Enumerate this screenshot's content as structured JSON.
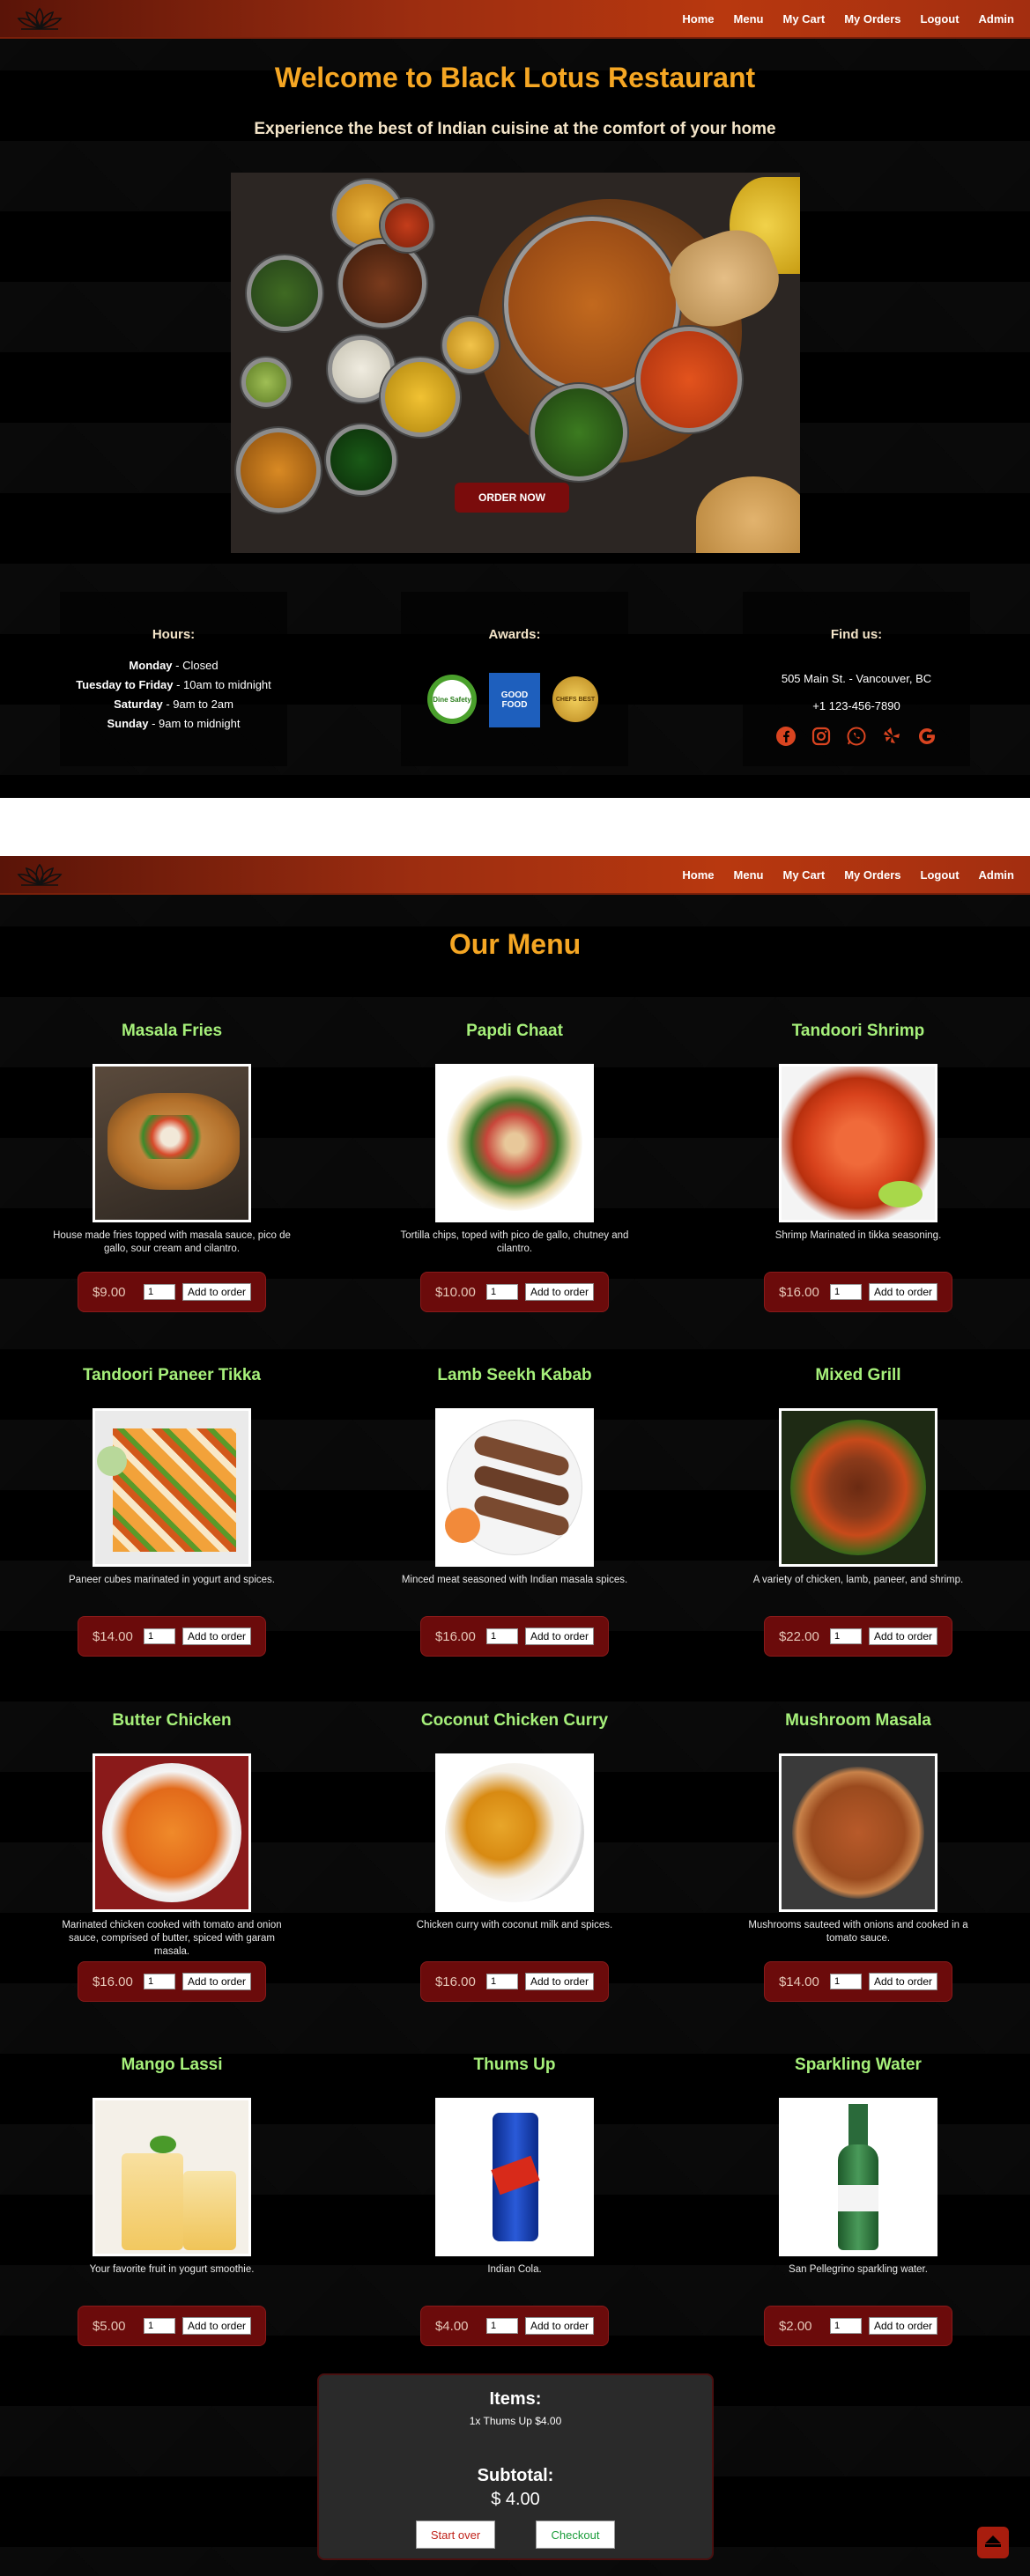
{
  "nav": {
    "items": [
      {
        "label": "Home"
      },
      {
        "label": "Menu"
      },
      {
        "label": "My Cart"
      },
      {
        "label": "My Orders"
      },
      {
        "label": "Logout"
      },
      {
        "label": "Admin"
      }
    ]
  },
  "home": {
    "title": "Welcome to Black Lotus Restaurant",
    "tagline": "Experience the best of Indian cuisine at the comfort of your home",
    "order_now": "ORDER NOW",
    "hours": {
      "title": "Hours:",
      "rows": [
        {
          "day": "Monday",
          "time": " - Closed"
        },
        {
          "day": "Tuesday to Friday",
          "time": " - 10am to midnight"
        },
        {
          "day": "Saturday",
          "time": " - 9am to 2am"
        },
        {
          "day": "Sunday",
          "time": " - 9am to midnight"
        }
      ]
    },
    "awards": {
      "title": "Awards:",
      "badges": [
        "Dine Safety",
        "GOOD FOOD",
        "CHEFS BEST"
      ]
    },
    "find_us": {
      "title": "Find us:",
      "address": "505 Main St. - Vancouver, BC",
      "phone": "+1 123-456-7890"
    }
  },
  "menu": {
    "title": "Our Menu",
    "add_label": "Add to order",
    "qty_default": "1",
    "items": [
      {
        "name": "Masala Fries",
        "desc": "House made fries topped with masala sauce, pico de gallo, sour cream and cilantro.",
        "price": "$9.00"
      },
      {
        "name": "Papdi Chaat",
        "desc": "Tortilla chips, toped with pico de gallo, chutney and cilantro.",
        "price": "$10.00"
      },
      {
        "name": "Tandoori Shrimp",
        "desc": "Shrimp Marinated in tikka seasoning.",
        "price": "$16.00"
      },
      {
        "name": "Tandoori Paneer Tikka",
        "desc": "Paneer cubes marinated in yogurt and spices.",
        "price": "$14.00"
      },
      {
        "name": "Lamb Seekh Kabab",
        "desc": "Minced meat seasoned with Indian masala spices.",
        "price": "$16.00"
      },
      {
        "name": "Mixed Grill",
        "desc": "A variety of chicken, lamb, paneer, and shrimp.",
        "price": "$22.00"
      },
      {
        "name": "Butter Chicken",
        "desc": "Marinated chicken cooked with tomato and onion sauce, comprised of butter, spiced with garam masala.",
        "price": "$16.00"
      },
      {
        "name": "Coconut Chicken Curry",
        "desc": "Chicken curry with coconut milk and spices.",
        "price": "$16.00"
      },
      {
        "name": "Mushroom Masala",
        "desc": "Mushrooms sauteed with onions and cooked in a tomato sauce.",
        "price": "$14.00"
      },
      {
        "name": "Mango Lassi",
        "desc": "Your favorite fruit in yogurt smoothie.",
        "price": "$5.00"
      },
      {
        "name": "Thums Up",
        "desc": "Indian Cola.",
        "price": "$4.00"
      },
      {
        "name": "Sparkling Water",
        "desc": "San Pellegrino sparkling water.",
        "price": "$2.00"
      }
    ]
  },
  "cart": {
    "items_title": "Items:",
    "line": "1x Thums Up $4.00",
    "subtotal_title": "Subtotal:",
    "subtotal": "$ 4.00",
    "start_over": "Start over",
    "checkout": "Checkout"
  },
  "colors": {
    "accent": "#f5a623",
    "item_name": "#a6f07a",
    "price_box": "#6b0b0b",
    "nav": "#b8380f"
  }
}
